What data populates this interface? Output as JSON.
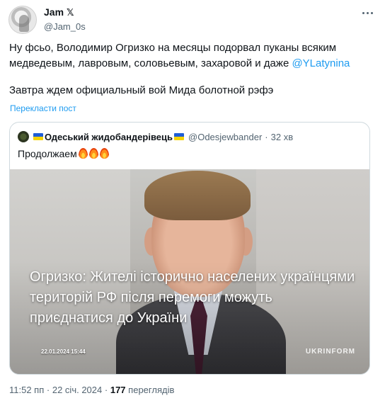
{
  "author": {
    "display_name": "Jam",
    "badge": "𝕏",
    "handle": "@Jam_0s"
  },
  "tweet": {
    "line1": "Ну фсьо, Володимир Огризко на месяцы подорвал пуканы всяким медведевым, лавровым, соловьевым, захаровой и даже ",
    "mention": "@YLatynina",
    "line2": "Завтра ждем официальный вой Мида болотной рэфэ",
    "translate_label": "Перекласти пост"
  },
  "quote": {
    "display_name": "Одеський жидобандерівець",
    "handle": "@Odesjewbander",
    "separator": "·",
    "time": "32 хв",
    "text": "Продолжаем",
    "photo": {
      "headline": "Огризко: Жителі історично населених українцями територій РФ після перемоги можуть приєднатися до України",
      "date": "22.01.2024 15:44",
      "brand": "UKRINFORM"
    }
  },
  "meta": {
    "time": "11:52 пп",
    "separator": "·",
    "date": "22 січ. 2024",
    "views_count": "177",
    "views_label": "переглядів"
  },
  "colors": {
    "accent": "#1d9bf0",
    "text": "#0f1419",
    "secondary": "#536471",
    "border": "#cfd9de"
  }
}
